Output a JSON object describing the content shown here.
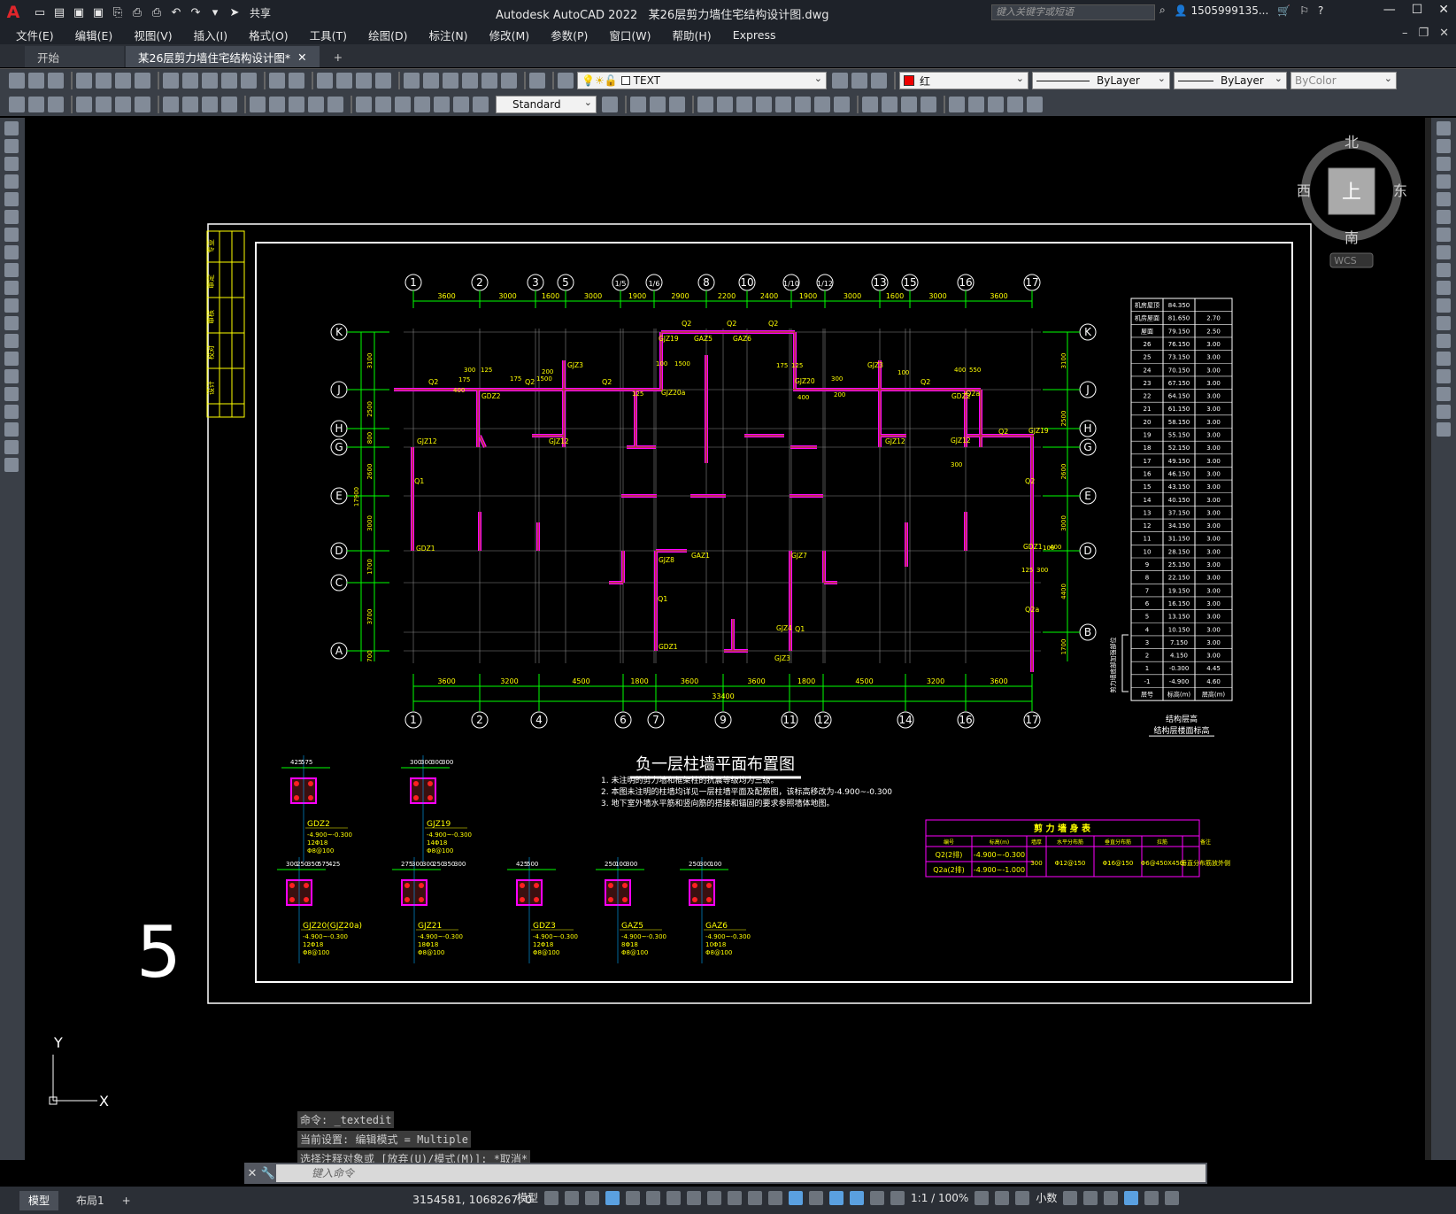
{
  "app": {
    "title": "Autodesk AutoCAD 2022",
    "file": "某26层剪力墙住宅结构设计图.dwg",
    "share": "共享",
    "search_placeholder": "键入关键字或短语",
    "user": "1505999135...",
    "quick_access_label": "▾"
  },
  "menus": [
    "文件(E)",
    "编辑(E)",
    "视图(V)",
    "插入(I)",
    "格式(O)",
    "工具(T)",
    "绘图(D)",
    "标注(N)",
    "修改(M)",
    "参数(P)",
    "窗口(W)",
    "帮助(H)",
    "Express"
  ],
  "tabs": [
    {
      "label": "开始"
    },
    {
      "label": "某26层剪力墙住宅结构设计图*"
    }
  ],
  "toolbar": {
    "layer": "TEXT",
    "color": "红",
    "linetype": "ByLayer",
    "lineweight": "ByLayer",
    "plotstyle": "ByColor",
    "textstyle": "Standard"
  },
  "viewcube": {
    "north": "北",
    "south": "南",
    "east": "东",
    "west": "西",
    "top": "上",
    "wcs": "WCS"
  },
  "drawing": {
    "page_number": "5",
    "plan_title": "负一层柱墙平面布置图",
    "notes": [
      "1. 未注明的剪力墙和框架柱的抗震等级均为三级。",
      "2. 本图未注明的柱墙均详见一层柱墙平面及配筋图，该标高移改为-4.900~-0.300",
      "3. 地下室外墙水平筋和竖向筋的搭接和锚固的要求参照墙体地图。"
    ],
    "top_axes": [
      "1",
      "2",
      "3",
      "5",
      "1/5",
      "1/6",
      "8",
      "10",
      "1/10",
      "1/12",
      "13",
      "15",
      "16",
      "17"
    ],
    "top_dims": [
      "3600",
      "3000",
      "1600",
      "3000",
      "1900",
      "2900",
      "2200",
      "2400",
      "1900",
      "3000",
      "1600",
      "3000",
      "3600"
    ],
    "bottom_axes": [
      "1",
      "2",
      "4",
      "6",
      "7",
      "9",
      "11",
      "12",
      "14",
      "16",
      "17"
    ],
    "bottom_dims": [
      "3600",
      "3200",
      "4500",
      "1800",
      "3600",
      "3600",
      "1800",
      "4500",
      "3200",
      "3600"
    ],
    "bottom_total": "33400",
    "left_axes": [
      "K",
      "J",
      "H",
      "G",
      "E",
      "D",
      "C",
      "A"
    ],
    "right_axes": [
      "K",
      "J",
      "H",
      "G",
      "E",
      "D",
      "B"
    ],
    "left_dims": [
      "3100",
      "2500",
      "800",
      "2600",
      "3000",
      "1700",
      "3700",
      "700"
    ],
    "left_total": "17900",
    "right_dims": [
      "3100",
      "2500",
      "2600",
      "3000",
      "4400",
      "1700"
    ],
    "wall_labels": [
      "Q2",
      "Q2",
      "Q2",
      "Q2",
      "Q2",
      "Q2",
      "Q2",
      "Q1",
      "Q1",
      "Q2",
      "Q2",
      "Q2a",
      "Q2a",
      "Q1"
    ],
    "column_labels": [
      "GJZ19",
      "GAZ5",
      "GAZ6",
      "GJZ3",
      "GJZ3",
      "GDZ2",
      "GDZ2",
      "GJZ20a",
      "GJZ20",
      "GJZ12",
      "GJZ12",
      "GJZ12",
      "GJZ12",
      "GJZ19",
      "GDZ1",
      "GJZ8",
      "GAZ1",
      "GJZ7",
      "GDZ1",
      "GJZ4",
      "GJZ3",
      "GDZ1"
    ],
    "dim_labels": [
      "300",
      "125",
      "175",
      "400",
      "175",
      "1500",
      "200",
      "100",
      "1500",
      "175",
      "125",
      "300",
      "100",
      "200",
      "400",
      "550",
      "400",
      "125",
      "300",
      "100",
      "125",
      "300",
      "400"
    ],
    "floor_table": {
      "rows": [
        [
          "机房屋顶",
          "84.350",
          ""
        ],
        [
          "机房屋面",
          "81.650",
          "2.70"
        ],
        [
          "屋面",
          "79.150",
          "2.50"
        ],
        [
          "26",
          "76.150",
          "3.00"
        ],
        [
          "25",
          "73.150",
          "3.00"
        ],
        [
          "24",
          "70.150",
          "3.00"
        ],
        [
          "23",
          "67.150",
          "3.00"
        ],
        [
          "22",
          "64.150",
          "3.00"
        ],
        [
          "21",
          "61.150",
          "3.00"
        ],
        [
          "20",
          "58.150",
          "3.00"
        ],
        [
          "19",
          "55.150",
          "3.00"
        ],
        [
          "18",
          "52.150",
          "3.00"
        ],
        [
          "17",
          "49.150",
          "3.00"
        ],
        [
          "16",
          "46.150",
          "3.00"
        ],
        [
          "15",
          "43.150",
          "3.00"
        ],
        [
          "14",
          "40.150",
          "3.00"
        ],
        [
          "13",
          "37.150",
          "3.00"
        ],
        [
          "12",
          "34.150",
          "3.00"
        ],
        [
          "11",
          "31.150",
          "3.00"
        ],
        [
          "10",
          "28.150",
          "3.00"
        ],
        [
          "9",
          "25.150",
          "3.00"
        ],
        [
          "8",
          "22.150",
          "3.00"
        ],
        [
          "7",
          "19.150",
          "3.00"
        ],
        [
          "6",
          "16.150",
          "3.00"
        ],
        [
          "5",
          "13.150",
          "3.00"
        ],
        [
          "4",
          "10.150",
          "3.00"
        ],
        [
          "3",
          "7.150",
          "3.00"
        ],
        [
          "2",
          "4.150",
          "3.00"
        ],
        [
          "1",
          "-0.300",
          "4.45"
        ],
        [
          "-1",
          "-4.900",
          "4.60"
        ]
      ],
      "header": [
        "层号",
        "标高(m)",
        "层高(m)"
      ],
      "caption1": "结构层高",
      "caption2": "结构层楼面标高",
      "side_label": "剪力墙底部加强部位"
    },
    "wall_table": {
      "title": "剪 力 墙 身 表",
      "header": [
        "编号",
        "标高(m)",
        "墙厚",
        "水平分布筋",
        "垂直分布筋",
        "拉筋",
        "备注"
      ],
      "rows": [
        [
          "Q2(2排)",
          "-4.900~-0.300",
          "300",
          "Φ12@150",
          "Φ16@150",
          "Φ6@450X450",
          "垂直分布筋放外侧"
        ],
        [
          "Q2a(2排)",
          "-4.900~-1.000",
          "",
          "",
          "",
          "",
          ""
        ]
      ]
    },
    "details": [
      {
        "name": "GDZ2",
        "elev": "-4.900~-0.300",
        "bars": "12Φ18",
        "stirrup": "Φ8@100",
        "dims": [
          "425",
          "575"
        ]
      },
      {
        "name": "GJZ19",
        "elev": "-4.900~-0.300",
        "bars": "14Φ18",
        "stirrup": "Φ8@100",
        "dims": [
          "300",
          "300",
          "300",
          "300"
        ]
      },
      {
        "name": "GJZ20(GJZ20a)",
        "elev": "-4.900~-0.300",
        "bars": "12Φ18",
        "stirrup": "Φ8@100",
        "dims": [
          "300",
          "250",
          "350",
          "575",
          "425"
        ]
      },
      {
        "name": "GJZ21",
        "elev": "-4.900~-0.300",
        "bars": "18Φ18",
        "stirrup": "Φ8@100",
        "dims": [
          "275",
          "300",
          "300",
          "250",
          "350",
          "300"
        ]
      },
      {
        "name": "GDZ3",
        "elev": "-4.900~-0.300",
        "bars": "12Φ18",
        "stirrup": "Φ8@100",
        "dims": [
          "425",
          "500"
        ]
      },
      {
        "name": "GAZ5",
        "elev": "-4.900~-0.300",
        "bars": "8Φ18",
        "stirrup": "Φ8@100",
        "dims": [
          "250",
          "100",
          "300"
        ]
      },
      {
        "name": "GAZ6",
        "elev": "-4.900~-0.300",
        "bars": "10Φ18",
        "stirrup": "Φ8@100",
        "dims": [
          "250",
          "300",
          "100"
        ]
      }
    ],
    "titleblock_cells": [
      "专业",
      "审定",
      "审核",
      "校对",
      "设计"
    ]
  },
  "command": {
    "history": [
      "命令: _textedit",
      "当前设置: 编辑模式 = Multiple",
      "选择注释对象或 [放弃(U)/模式(M)]: *取消*"
    ],
    "placeholder": "键入命令"
  },
  "status": {
    "layouts": [
      "模型",
      "布局1"
    ],
    "coords": "3154581, 1068267, 0",
    "model": "模型",
    "scale": "1:1 / 100%",
    "units": "小数",
    "ucs_x": "X",
    "ucs_y": "Y"
  },
  "colors": {
    "grid": "#ffffff",
    "wall": "#ff00ff",
    "dim": "#00ff00",
    "text": "#ffff00",
    "bg": "#000000"
  }
}
